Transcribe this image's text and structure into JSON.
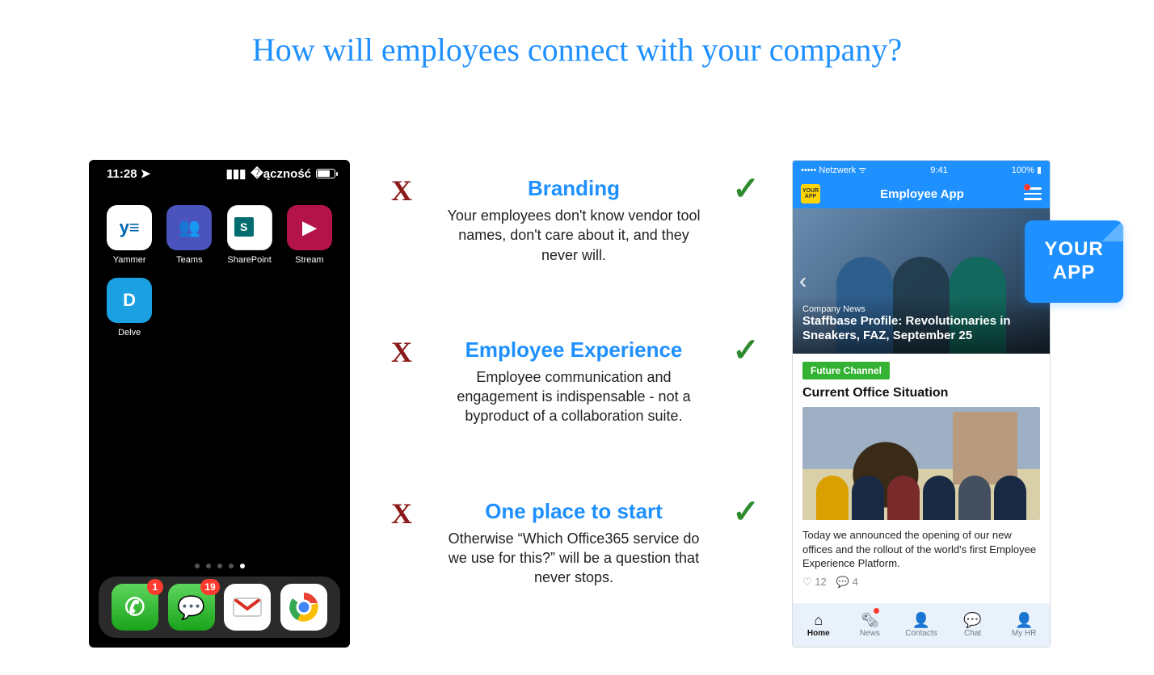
{
  "title": "How will employees connect with your company?",
  "marks": {
    "x": "X",
    "check": "✓"
  },
  "rows": [
    {
      "heading": "Branding",
      "body": "Your employees don't know vendor tool names, don't care about it, and they never will."
    },
    {
      "heading": "Employee Experience",
      "body": "Employee communication and engagement is indispensable - not a byproduct of a collaboration suite."
    },
    {
      "heading": "One place to start",
      "body": "Otherwise “Which Office365 service do we use for this?” will be a question that never stops."
    }
  ],
  "iphone": {
    "time": "11:28",
    "apps": [
      {
        "name": "Yammer",
        "glyph": "y≡"
      },
      {
        "name": "Teams",
        "glyph": "👥"
      },
      {
        "name": "SharePoint",
        "glyph": "S"
      },
      {
        "name": "Stream",
        "glyph": "▶"
      },
      {
        "name": "Delve",
        "glyph": "D"
      }
    ],
    "dock_badges": {
      "phone": "1",
      "messages": "19"
    }
  },
  "empapp": {
    "carrier": "Netzwerk",
    "clock": "9:41",
    "battery": "100%",
    "header_title": "Employee App",
    "logo_text": "YOUR APP",
    "hero": {
      "category": "Company News",
      "headline": "Staffbase Profile: Revolutionaries in Sneakers, FAZ, September 25"
    },
    "card": {
      "tag": "Future Channel",
      "title": "Current Office Situation",
      "desc": "Today we announced the opening of our new offices and the rollout of the world's first Employee Experience Platform.",
      "likes": "12",
      "comments": "4"
    },
    "tabs": [
      {
        "label": "Home",
        "icon": "⌂",
        "active": true,
        "dot": false
      },
      {
        "label": "News",
        "icon": "🗞",
        "active": false,
        "dot": true
      },
      {
        "label": "Contacts",
        "icon": "👤",
        "active": false,
        "dot": false
      },
      {
        "label": "Chat",
        "icon": "💬",
        "active": false,
        "dot": false
      },
      {
        "label": "My HR",
        "icon": "👤",
        "active": false,
        "dot": false
      }
    ]
  },
  "sticker": "YOUR APP"
}
